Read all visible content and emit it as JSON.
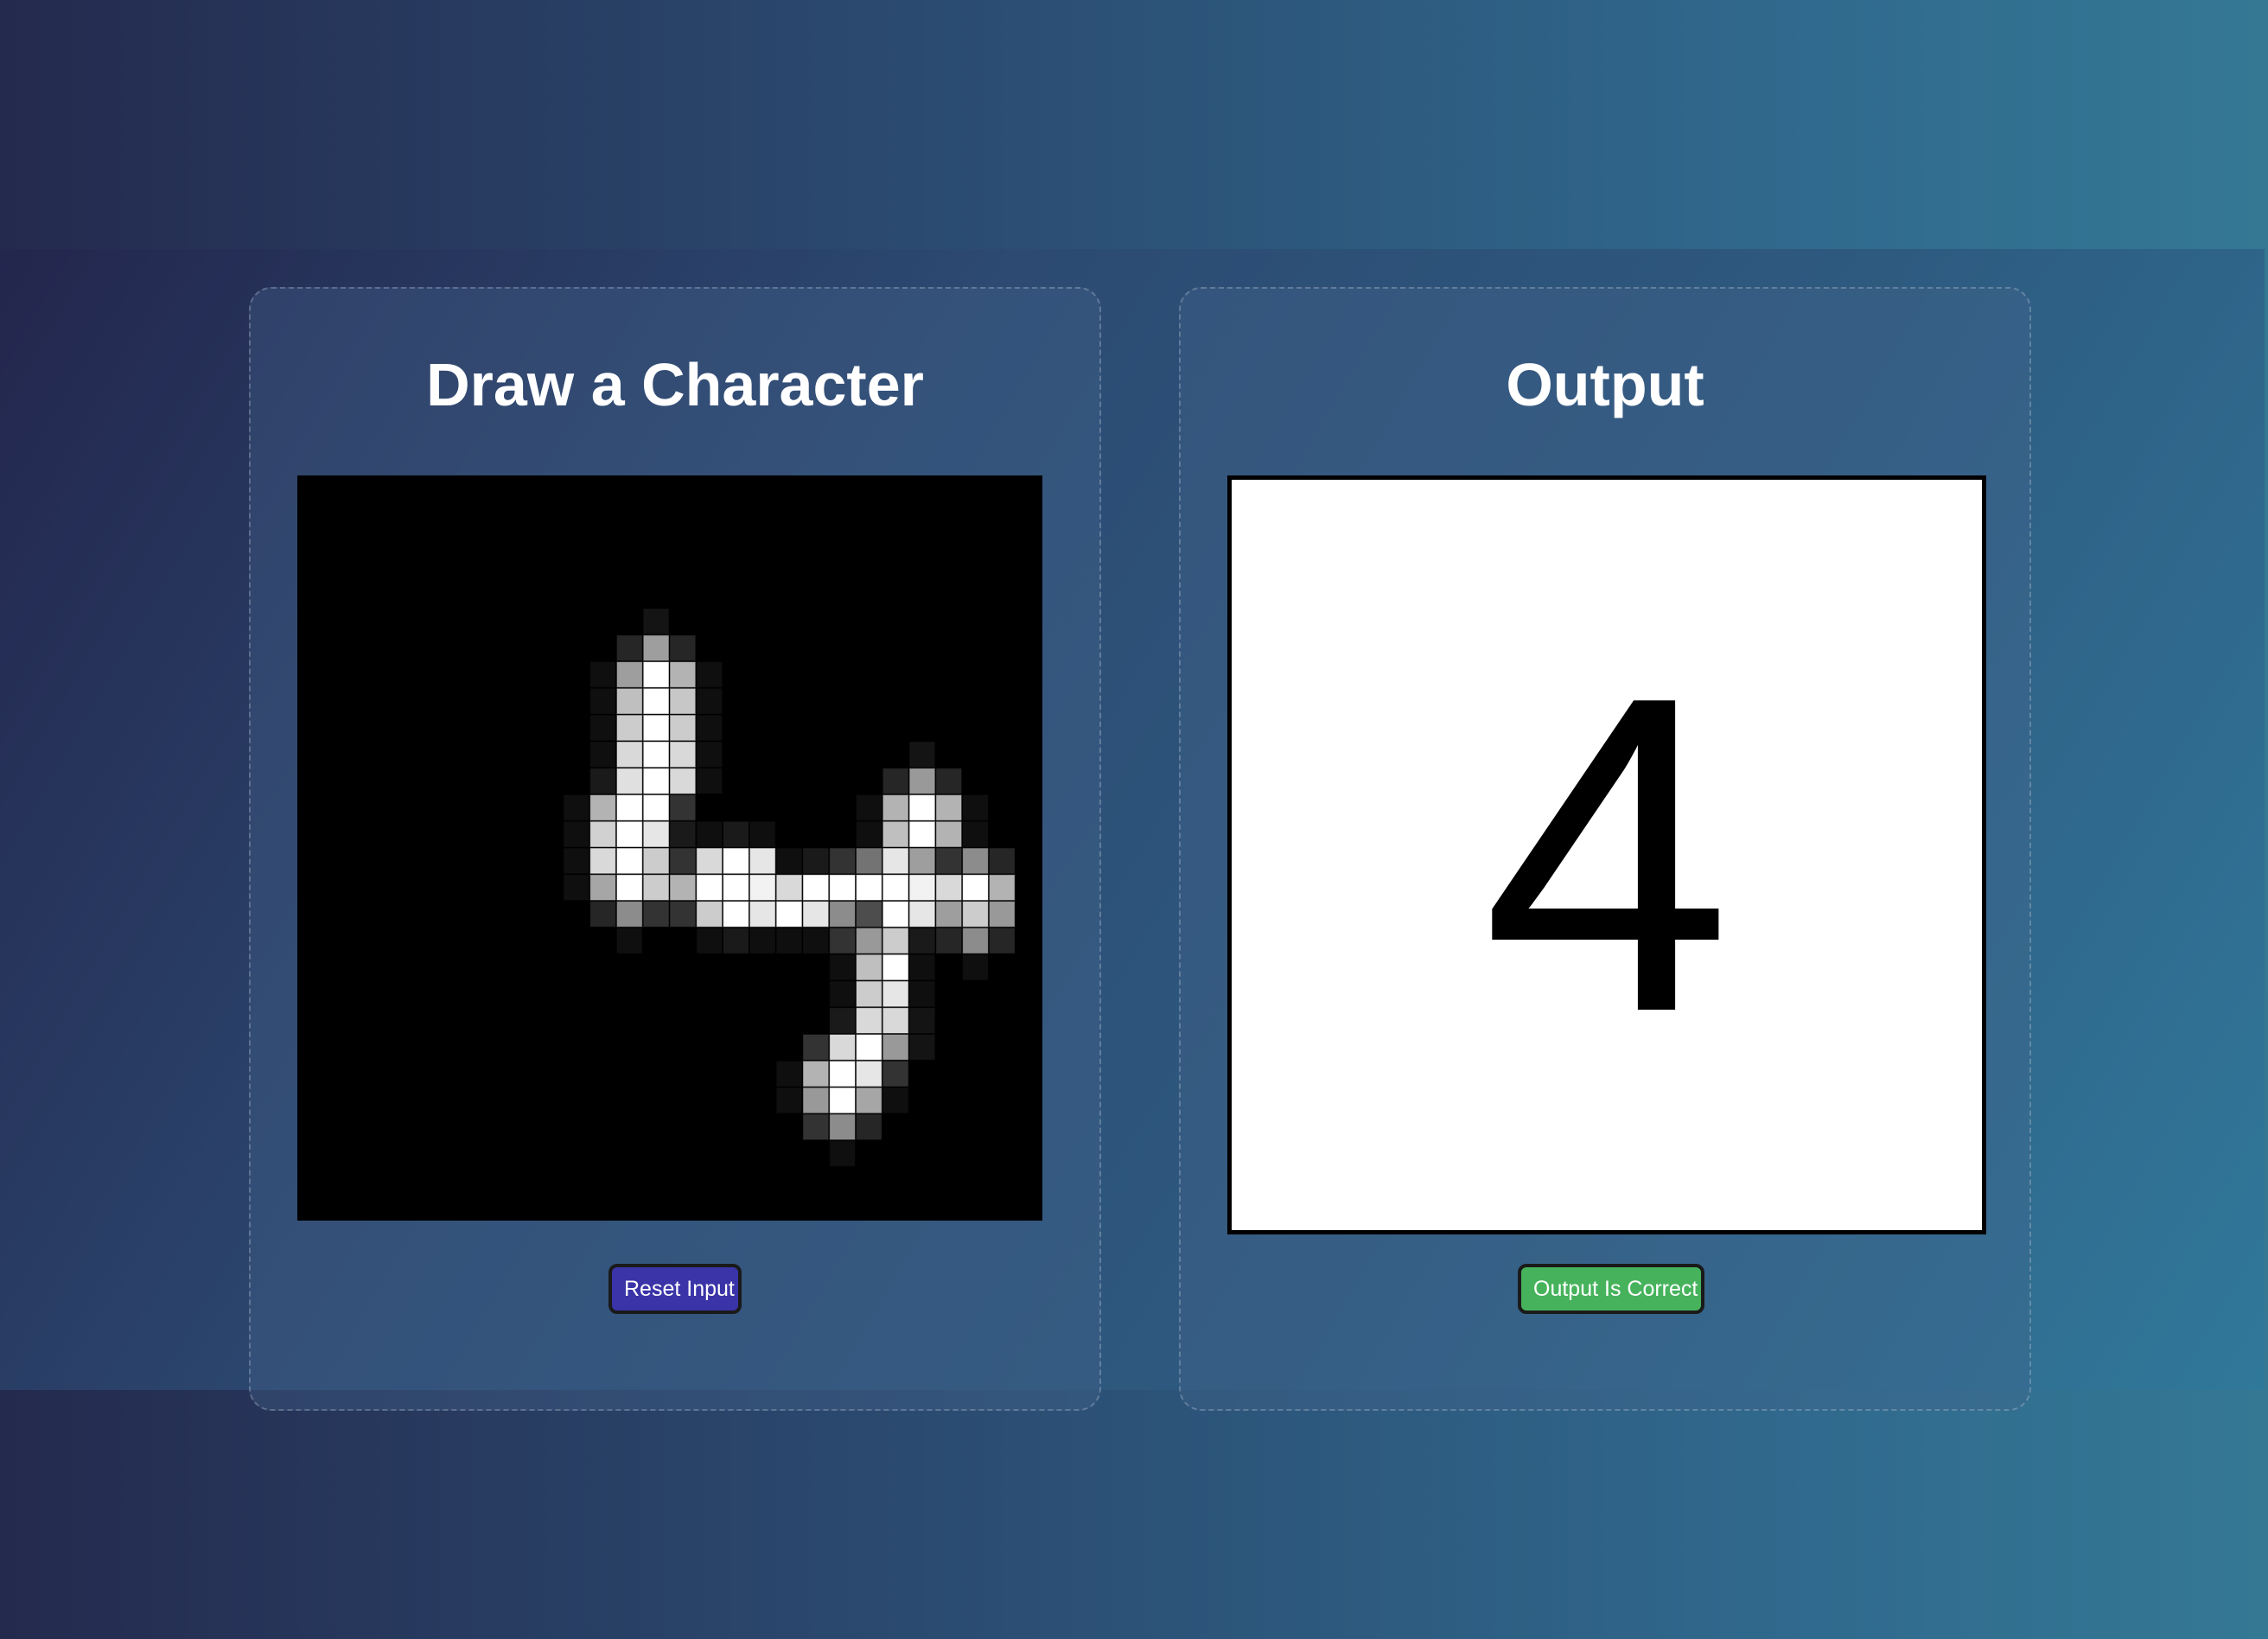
{
  "input_panel": {
    "title": "Draw a Character",
    "reset_label": "Reset Input",
    "grid_size": 28,
    "pixels": [
      [
        8,
        20,
        0.08
      ],
      [
        9,
        19,
        0.15
      ],
      [
        9,
        20,
        0.62
      ],
      [
        9,
        21,
        0.15
      ],
      [
        10,
        18,
        0.06
      ],
      [
        10,
        19,
        0.62
      ],
      [
        10,
        20,
        1.0
      ],
      [
        10,
        21,
        0.7
      ],
      [
        10,
        22,
        0.06
      ],
      [
        11,
        18,
        0.06
      ],
      [
        11,
        19,
        0.75
      ],
      [
        11,
        20,
        1.0
      ],
      [
        11,
        21,
        0.78
      ],
      [
        11,
        22,
        0.06
      ],
      [
        12,
        18,
        0.06
      ],
      [
        12,
        19,
        0.8
      ],
      [
        12,
        20,
        1.0
      ],
      [
        12,
        21,
        0.8
      ],
      [
        12,
        22,
        0.06
      ],
      [
        13,
        18,
        0.06
      ],
      [
        13,
        19,
        0.85
      ],
      [
        13,
        20,
        1.0
      ],
      [
        13,
        21,
        0.85
      ],
      [
        13,
        22,
        0.06
      ],
      [
        14,
        18,
        0.1
      ],
      [
        14,
        19,
        0.88
      ],
      [
        14,
        20,
        1.0
      ],
      [
        14,
        21,
        0.85
      ],
      [
        14,
        22,
        0.06
      ],
      [
        15,
        17,
        0.06
      ],
      [
        15,
        18,
        0.7
      ],
      [
        15,
        19,
        1.0
      ],
      [
        15,
        20,
        1.0
      ],
      [
        15,
        21,
        0.2
      ],
      [
        16,
        17,
        0.06
      ],
      [
        16,
        18,
        0.82
      ],
      [
        16,
        19,
        1.0
      ],
      [
        16,
        20,
        0.9
      ],
      [
        16,
        21,
        0.1
      ],
      [
        16,
        22,
        0.06
      ],
      [
        16,
        23,
        0.1
      ],
      [
        16,
        24,
        0.06
      ],
      [
        17,
        17,
        0.06
      ],
      [
        17,
        18,
        0.85
      ],
      [
        17,
        19,
        1.0
      ],
      [
        17,
        20,
        0.8
      ],
      [
        17,
        21,
        0.2
      ],
      [
        17,
        22,
        0.85
      ],
      [
        17,
        23,
        1.0
      ],
      [
        17,
        24,
        0.9
      ],
      [
        18,
        17,
        0.06
      ],
      [
        18,
        18,
        0.65
      ],
      [
        18,
        19,
        1.0
      ],
      [
        18,
        20,
        0.8
      ],
      [
        18,
        21,
        0.7
      ],
      [
        18,
        22,
        1.0
      ],
      [
        18,
        23,
        1.0
      ],
      [
        18,
        24,
        0.95
      ],
      [
        19,
        18,
        0.15
      ],
      [
        19,
        19,
        0.55
      ],
      [
        19,
        20,
        0.2
      ],
      [
        19,
        21,
        0.2
      ],
      [
        19,
        22,
        0.8
      ],
      [
        19,
        23,
        1.0
      ],
      [
        19,
        24,
        0.9
      ],
      [
        20,
        19,
        0.06
      ],
      [
        20,
        22,
        0.06
      ],
      [
        20,
        23,
        0.1
      ],
      [
        20,
        24,
        0.06
      ],
      [
        13,
        30,
        0.08
      ],
      [
        14,
        29,
        0.15
      ],
      [
        14,
        30,
        0.6
      ],
      [
        14,
        31,
        0.15
      ],
      [
        15,
        28,
        0.06
      ],
      [
        15,
        29,
        0.7
      ],
      [
        15,
        30,
        1.0
      ],
      [
        15,
        31,
        0.7
      ],
      [
        15,
        32,
        0.06
      ],
      [
        16,
        28,
        0.06
      ],
      [
        16,
        29,
        0.75
      ],
      [
        16,
        30,
        1.0
      ],
      [
        16,
        31,
        0.7
      ],
      [
        16,
        32,
        0.06
      ],
      [
        17,
        25,
        0.06
      ],
      [
        17,
        26,
        0.1
      ],
      [
        17,
        27,
        0.2
      ],
      [
        17,
        28,
        0.45
      ],
      [
        17,
        29,
        0.9
      ],
      [
        17,
        30,
        0.62
      ],
      [
        17,
        31,
        0.2
      ],
      [
        17,
        32,
        0.55
      ],
      [
        17,
        33,
        0.15
      ],
      [
        18,
        25,
        0.85
      ],
      [
        18,
        26,
        1.0
      ],
      [
        18,
        27,
        1.0
      ],
      [
        18,
        28,
        1.0
      ],
      [
        18,
        29,
        1.0
      ],
      [
        18,
        30,
        0.95
      ],
      [
        18,
        31,
        0.85
      ],
      [
        18,
        32,
        1.0
      ],
      [
        18,
        33,
        0.7
      ],
      [
        18,
        34,
        0.06
      ],
      [
        19,
        25,
        1.0
      ],
      [
        19,
        26,
        0.9
      ],
      [
        19,
        27,
        0.55
      ],
      [
        19,
        28,
        0.3
      ],
      [
        19,
        29,
        1.0
      ],
      [
        19,
        30,
        0.9
      ],
      [
        19,
        31,
        0.62
      ],
      [
        19,
        32,
        0.8
      ],
      [
        19,
        33,
        0.6
      ],
      [
        19,
        34,
        0.06
      ],
      [
        20,
        25,
        0.06
      ],
      [
        20,
        26,
        0.06
      ],
      [
        20,
        27,
        0.2
      ],
      [
        20,
        28,
        0.6
      ],
      [
        20,
        29,
        0.8
      ],
      [
        20,
        30,
        0.1
      ],
      [
        20,
        31,
        0.15
      ],
      [
        20,
        32,
        0.55
      ],
      [
        20,
        33,
        0.15
      ],
      [
        21,
        27,
        0.06
      ],
      [
        21,
        28,
        0.75
      ],
      [
        21,
        29,
        1.0
      ],
      [
        21,
        30,
        0.06
      ],
      [
        21,
        32,
        0.06
      ],
      [
        22,
        27,
        0.06
      ],
      [
        22,
        28,
        0.8
      ],
      [
        22,
        29,
        0.9
      ],
      [
        22,
        30,
        0.06
      ],
      [
        23,
        27,
        0.1
      ],
      [
        23,
        28,
        0.85
      ],
      [
        23,
        29,
        0.85
      ],
      [
        23,
        30,
        0.08
      ],
      [
        24,
        26,
        0.2
      ],
      [
        24,
        27,
        0.85
      ],
      [
        24,
        28,
        1.0
      ],
      [
        24,
        29,
        0.6
      ],
      [
        24,
        30,
        0.08
      ],
      [
        25,
        25,
        0.06
      ],
      [
        25,
        26,
        0.7
      ],
      [
        25,
        27,
        1.0
      ],
      [
        25,
        28,
        0.9
      ],
      [
        25,
        29,
        0.2
      ],
      [
        26,
        25,
        0.06
      ],
      [
        26,
        26,
        0.6
      ],
      [
        26,
        27,
        1.0
      ],
      [
        26,
        28,
        0.65
      ],
      [
        26,
        29,
        0.06
      ],
      [
        27,
        26,
        0.2
      ],
      [
        27,
        27,
        0.55
      ],
      [
        27,
        28,
        0.15
      ],
      [
        28,
        27,
        0.06
      ]
    ]
  },
  "output_panel": {
    "title": "Output",
    "predicted_character": "4",
    "correct_label": "Output Is Correct"
  },
  "colors": {
    "reset_button": "#3a34a8",
    "correct_button": "#46b35c",
    "canvas_background": "#000000",
    "output_background": "#ffffff"
  }
}
